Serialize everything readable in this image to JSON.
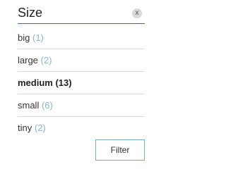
{
  "filter": {
    "title": "Size",
    "clear_label": "x",
    "options": [
      {
        "label": "big",
        "count": "(1)",
        "selected": false
      },
      {
        "label": "large",
        "count": "(2)",
        "selected": false
      },
      {
        "label": "medium",
        "count": "(13)",
        "selected": true
      },
      {
        "label": "small",
        "count": "(6)",
        "selected": false
      },
      {
        "label": "tiny",
        "count": "(2)",
        "selected": false
      }
    ],
    "submit_label": "Filter"
  },
  "colors": {
    "accent": "#2f6f8f",
    "count": "#8ab6cc",
    "button_border": "#7aa9c2"
  }
}
